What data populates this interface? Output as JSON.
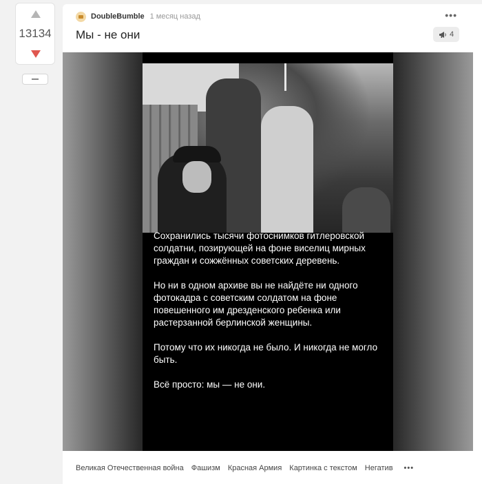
{
  "rating": {
    "score": "13134"
  },
  "story": {
    "author": "DoubleBumble",
    "time": "1 месяц назад",
    "title": "Мы - не они",
    "comments_count": "4",
    "more_glyph": "•••"
  },
  "image_text": {
    "paragraphs": [
      "Сохранились тысячи фотоснимков гитлеровской солдатни, позирующей на фоне виселиц мирных граждан и сожжённых советских деревень.",
      "Но ни в одном архиве вы не найдёте ни одного фотокадра с советским солдатом на фоне повешенного им дрезденского ребенка или растерзанной берлинской женщины.",
      "Потому что их никогда не было. И никогда не могло быть.",
      "Всё просто: мы — не они."
    ]
  },
  "tags": [
    "Великая Отечественная война",
    "Фашизм",
    "Красная Армия",
    "Картинка с текстом",
    "Негатив"
  ],
  "tags_more": "•••",
  "colors": {
    "downvote": "#e0574f",
    "upvote": "#b5b5b5",
    "background": "#f2f2f2"
  },
  "icons": [
    "upvote-arrow-icon",
    "downvote-arrow-icon",
    "collapse-icon",
    "avatar-icon",
    "more-icon",
    "megaphone-icon"
  ]
}
